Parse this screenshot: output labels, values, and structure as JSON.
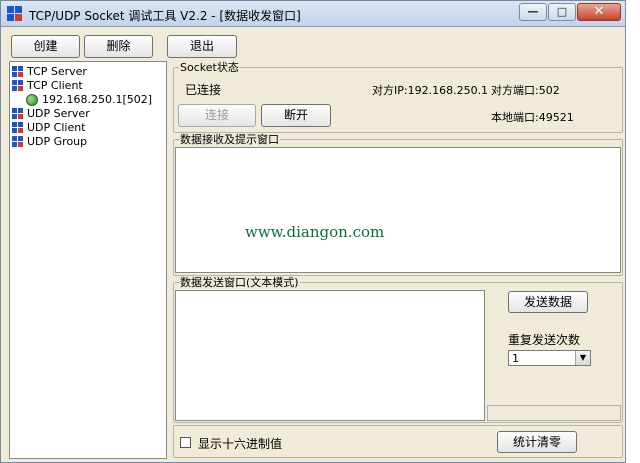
{
  "window": {
    "title": "TCP/UDP Socket 调试工具 V2.2 - [数据收发窗口]",
    "minimize_glyph": "—",
    "maximize_glyph": "□",
    "close_glyph": "✕"
  },
  "toolbar": {
    "create_label": "创建",
    "delete_label": "删除",
    "exit_label": "退出"
  },
  "tree": {
    "items": [
      {
        "label": "TCP Server",
        "icon": "network-icon"
      },
      {
        "label": "TCP Client",
        "icon": "network-icon"
      },
      {
        "label": "192.168.250.1[502]",
        "icon": "connection-globe-icon"
      },
      {
        "label": "UDP Server",
        "icon": "network-icon"
      },
      {
        "label": "UDP Client",
        "icon": "network-icon"
      },
      {
        "label": "UDP Group",
        "icon": "network-icon"
      }
    ]
  },
  "socket_status": {
    "group_label": "Socket状态",
    "state": "已连接",
    "remote_ip": "对方IP:192.168.250.1",
    "remote_port": "对方端口:502",
    "local_port": "本地端口:49521",
    "connect_label": "连接",
    "disconnect_label": "断开"
  },
  "receive": {
    "group_label": "数据接收及提示窗口",
    "content": "www.diangon.com"
  },
  "send": {
    "group_label": "数据发送窗口(文本模式)",
    "send_button_label": "发送数据",
    "repeat_label": "重复发送次数",
    "repeat_value": "1"
  },
  "footer": {
    "hex_checkbox_label": "显示十六进制值",
    "clear_stats_label": "统计清零"
  },
  "colors": {
    "window_bg": "#f0ead8",
    "titlebar": "#c3d3ea",
    "url_text": "#0b6d3c"
  }
}
